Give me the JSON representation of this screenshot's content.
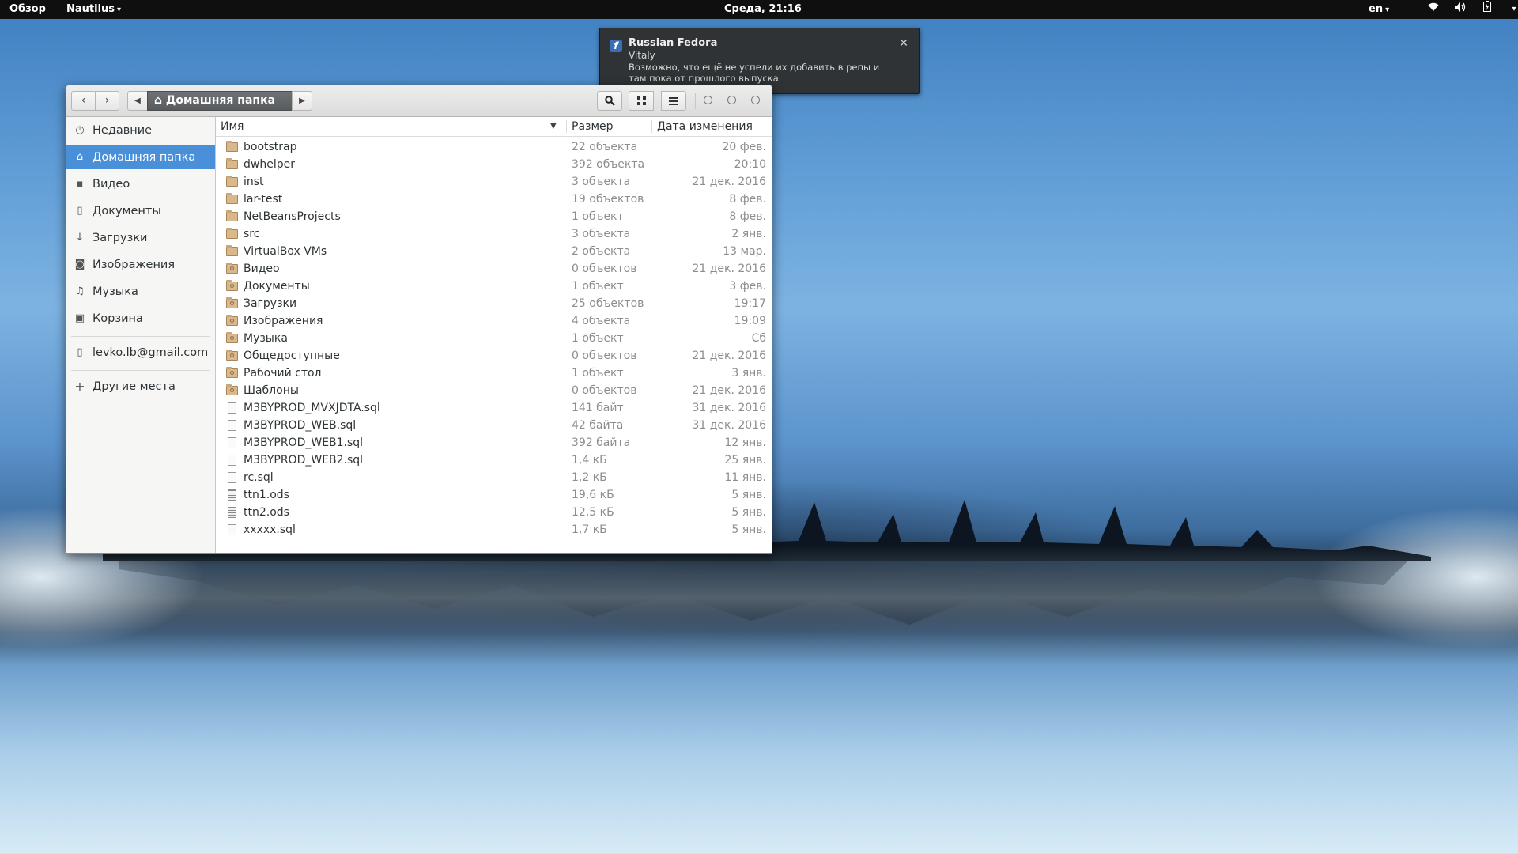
{
  "topbar": {
    "activities": "Обзор",
    "app_menu": "Nautilus",
    "clock": "Среда, 21:16",
    "lang": "en",
    "icons": [
      "wifi-icon",
      "volume-icon",
      "battery-icon",
      "system-menu-icon"
    ]
  },
  "notification": {
    "title": "Russian Fedora",
    "sender": "Vitaly",
    "body": "Возможно, что ещё не успели их добавить в репы и там пока от прошлого выпуска.",
    "icon": "fedora-icon"
  },
  "window": {
    "path_label": "Домашняя папка",
    "columns": {
      "name": "Имя",
      "size": "Размер",
      "date": "Дата изменения"
    }
  },
  "sidebar": {
    "items": [
      {
        "label": "Недавние",
        "icon": "recent-icon"
      },
      {
        "label": "Домашняя папка",
        "icon": "home-icon",
        "active": true
      },
      {
        "label": "Видео",
        "icon": "video-icon"
      },
      {
        "label": "Документы",
        "icon": "documents-icon"
      },
      {
        "label": "Загрузки",
        "icon": "downloads-icon"
      },
      {
        "label": "Изображения",
        "icon": "pictures-icon"
      },
      {
        "label": "Музыка",
        "icon": "music-icon"
      },
      {
        "label": "Корзина",
        "icon": "trash-icon"
      }
    ],
    "account": {
      "label": "levko.lb@gmail.com",
      "icon": "online-account-icon"
    },
    "other": {
      "label": "Другие места",
      "icon": "plus-icon"
    }
  },
  "files": [
    {
      "name": "bootstrap",
      "size": "22 объекта",
      "date": "20 фев.",
      "type": "folder"
    },
    {
      "name": "dwhelper",
      "size": "392 объекта",
      "date": "20:10",
      "type": "folder"
    },
    {
      "name": "inst",
      "size": "3 объекта",
      "date": "21 дек. 2016",
      "type": "folder"
    },
    {
      "name": "lar-test",
      "size": "19 объектов",
      "date": "8 фев.",
      "type": "folder"
    },
    {
      "name": "NetBeansProjects",
      "size": "1 объект",
      "date": "8 фев.",
      "type": "folder"
    },
    {
      "name": "src",
      "size": "3 объекта",
      "date": "2 янв.",
      "type": "folder"
    },
    {
      "name": "VirtualBox VMs",
      "size": "2 объекта",
      "date": "13 мар.",
      "type": "folder"
    },
    {
      "name": "Видео",
      "size": "0 объектов",
      "date": "21 дек. 2016",
      "type": "special-folder"
    },
    {
      "name": "Документы",
      "size": "1 объект",
      "date": "3 фев.",
      "type": "special-folder"
    },
    {
      "name": "Загрузки",
      "size": "25 объектов",
      "date": "19:17",
      "type": "special-folder"
    },
    {
      "name": "Изображения",
      "size": "4 объекта",
      "date": "19:09",
      "type": "special-folder"
    },
    {
      "name": "Музыка",
      "size": "1 объект",
      "date": "Сб",
      "type": "special-folder"
    },
    {
      "name": "Общедоступные",
      "size": "0 объектов",
      "date": "21 дек. 2016",
      "type": "special-folder"
    },
    {
      "name": "Рабочий стол",
      "size": "1 объект",
      "date": "3 янв.",
      "type": "special-folder"
    },
    {
      "name": "Шаблоны",
      "size": "0 объектов",
      "date": "21 дек. 2016",
      "type": "special-folder"
    },
    {
      "name": "M3BYPROD_MVXJDTA.sql",
      "size": "141 байт",
      "date": "31 дек. 2016",
      "type": "file"
    },
    {
      "name": "M3BYPROD_WEB.sql",
      "size": "42 байта",
      "date": "31 дек. 2016",
      "type": "file"
    },
    {
      "name": "M3BYPROD_WEB1.sql",
      "size": "392 байта",
      "date": "12 янв.",
      "type": "file"
    },
    {
      "name": "M3BYPROD_WEB2.sql",
      "size": "1,4 кБ",
      "date": "25 янв.",
      "type": "file"
    },
    {
      "name": "rc.sql",
      "size": "1,2 кБ",
      "date": "11 янв.",
      "type": "file"
    },
    {
      "name": "ttn1.ods",
      "size": "19,6 кБ",
      "date": "5 янв.",
      "type": "spreadsheet"
    },
    {
      "name": "ttn2.ods",
      "size": "12,5 кБ",
      "date": "5 янв.",
      "type": "spreadsheet"
    },
    {
      "name": "xxxxx.sql",
      "size": "1,7 кБ",
      "date": "5 янв.",
      "type": "file"
    }
  ]
}
